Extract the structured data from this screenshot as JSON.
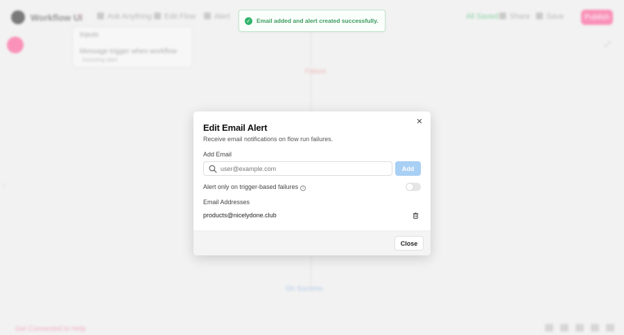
{
  "background": {
    "app_name": "Workflow UI",
    "nav": [
      "Ask Anything",
      "Edit Flow",
      "Alert"
    ],
    "status": "All Saved",
    "header_buttons": [
      "Share",
      "Save"
    ],
    "publish_label": "Publish",
    "panel": {
      "title": "Inputs",
      "row": "Message trigger when workflow",
      "sub": "Incoming alert"
    },
    "node_red": "Failure",
    "node_blue": "On Success",
    "footer_link": "Get Connected to Help"
  },
  "toast": {
    "message": "Email added and alert created successfully.",
    "color": "#2fb36a"
  },
  "modal": {
    "title": "Edit Email Alert",
    "description": "Receive email notifications on flow run failures.",
    "add_email_label": "Add Email",
    "email_input": {
      "value": "",
      "placeholder": "user@example.com"
    },
    "add_button": "Add",
    "trigger_toggle_label": "Alert only on trigger-based failures",
    "trigger_toggle_on": false,
    "addresses_label": "Email Addresses",
    "addresses": [
      "products@nicelydone.club"
    ],
    "close_button": "Close",
    "accent_color": "#a8cff4"
  }
}
